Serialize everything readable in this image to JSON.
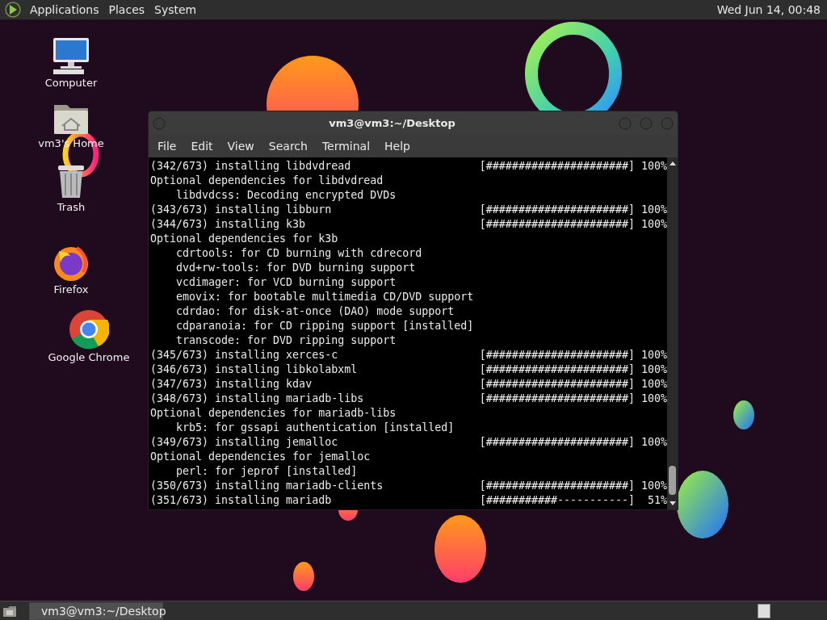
{
  "top_panel": {
    "menus": [
      "Applications",
      "Places",
      "System"
    ],
    "clock": "Wed Jun 14, 00:48"
  },
  "desktop_icons": [
    {
      "kind": "computer",
      "label": "Computer"
    },
    {
      "kind": "home",
      "label": "vm3's Home"
    },
    {
      "kind": "trash",
      "label": "Trash"
    },
    {
      "kind": "firefox",
      "label": "Firefox"
    },
    {
      "kind": "chrome",
      "label": "Google Chrome"
    }
  ],
  "terminal": {
    "title": "vm3@vm3:~/Desktop",
    "menus": [
      "File",
      "Edit",
      "View",
      "Search",
      "Terminal",
      "Help"
    ],
    "lines": [
      {
        "kind": "progress",
        "text": "(342/673) installing libdvdread",
        "bar": "[######################]",
        "percent": "100%"
      },
      {
        "kind": "header",
        "text": "Optional dependencies for libdvdread"
      },
      {
        "kind": "detail",
        "text": "libdvdcss: Decoding encrypted DVDs"
      },
      {
        "kind": "progress",
        "text": "(343/673) installing libburn",
        "bar": "[######################]",
        "percent": "100%"
      },
      {
        "kind": "progress",
        "text": "(344/673) installing k3b",
        "bar": "[######################]",
        "percent": "100%"
      },
      {
        "kind": "header",
        "text": "Optional dependencies for k3b"
      },
      {
        "kind": "detail",
        "text": "cdrtools: for CD burning with cdrecord"
      },
      {
        "kind": "detail",
        "text": "dvd+rw-tools: for DVD burning support"
      },
      {
        "kind": "detail",
        "text": "vcdimager: for VCD burning support"
      },
      {
        "kind": "detail",
        "text": "emovix: for bootable multimedia CD/DVD support"
      },
      {
        "kind": "detail",
        "text": "cdrdao: for disk-at-once (DAO) mode support"
      },
      {
        "kind": "detail",
        "text": "cdparanoia: for CD ripping support [installed]"
      },
      {
        "kind": "detail",
        "text": "transcode: for DVD ripping support"
      },
      {
        "kind": "progress",
        "text": "(345/673) installing xerces-c",
        "bar": "[######################]",
        "percent": "100%"
      },
      {
        "kind": "progress",
        "text": "(346/673) installing libkolabxml",
        "bar": "[######################]",
        "percent": "100%"
      },
      {
        "kind": "progress",
        "text": "(347/673) installing kdav",
        "bar": "[######################]",
        "percent": "100%"
      },
      {
        "kind": "progress",
        "text": "(348/673) installing mariadb-libs",
        "bar": "[######################]",
        "percent": "100%"
      },
      {
        "kind": "header",
        "text": "Optional dependencies for mariadb-libs"
      },
      {
        "kind": "detail",
        "text": "krb5: for gssapi authentication [installed]"
      },
      {
        "kind": "progress",
        "text": "(349/673) installing jemalloc",
        "bar": "[######################]",
        "percent": "100%"
      },
      {
        "kind": "header",
        "text": "Optional dependencies for jemalloc"
      },
      {
        "kind": "detail",
        "text": "perl: for jeprof [installed]"
      },
      {
        "kind": "progress",
        "text": "(350/673) installing mariadb-clients",
        "bar": "[######################]",
        "percent": "100%"
      },
      {
        "kind": "progress",
        "text": "(351/673) installing mariadb",
        "bar": "[###########-----------]",
        "percent": "51%"
      }
    ]
  },
  "taskbar": {
    "tasks": [
      {
        "label": "vm3@vm3:~/Desktop",
        "selected": true
      }
    ]
  }
}
